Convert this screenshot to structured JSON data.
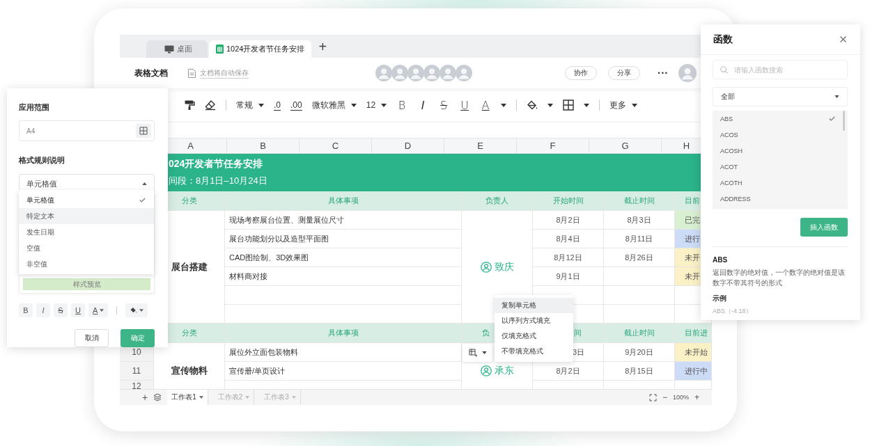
{
  "tabs": [
    {
      "label": "桌面",
      "kind": "desktop",
      "selected": false
    },
    {
      "label": "1024开发者节任务安排",
      "kind": "sheet",
      "selected": true
    }
  ],
  "new_tab": "+",
  "header": {
    "app": "表格文档",
    "autosave": "文档将自动保存",
    "collaborate": "协作",
    "share": "分享",
    "more": "•••"
  },
  "toolbar": {
    "number_format": "常规",
    "decrease_decimal": ".0",
    "increase_decimal": ".00",
    "font": "微软雅黑",
    "size": "12",
    "bold": "B",
    "italic": "I",
    "strike": "S",
    "underline": "U",
    "font_color": "A",
    "more": "更多"
  },
  "columns": [
    "A",
    "B",
    "C",
    "D",
    "E",
    "F",
    "G",
    "H"
  ],
  "sheet_title": "024开发者节任务安排",
  "period": "间段：8月1日–10月24日",
  "sections": [
    {
      "headers": {
        "category": "分类",
        "task": "具体事项",
        "owner": "负责人",
        "start": "开始时间",
        "end": "截止时间",
        "progress": "目前"
      },
      "category": "展台搭建",
      "owner": "致庆",
      "rows": [
        {
          "task": "现场考察展台位置、测量展位尺寸",
          "start": "8月2日",
          "end": "8月3日",
          "status": "已完",
          "color": "#d9efd1"
        },
        {
          "task": "展台功能划分以及造型平面图",
          "start": "8月4日",
          "end": "8月11日",
          "status": "进行",
          "color": "#cddcf6"
        },
        {
          "task": "CAD图绘制、3D效果图",
          "start": "8月12日",
          "end": "8月26日",
          "status": "未开",
          "color": "#fbf1c7"
        },
        {
          "task": "材料商对接",
          "start": "9月1日",
          "status": "未开",
          "color": "#fbf1c7"
        },
        {},
        {}
      ]
    },
    {
      "headers": {
        "category": "分类",
        "task": "具体事项",
        "owner": "负",
        "start": "间",
        "end": "截止时间",
        "progress": "目前进"
      },
      "category": "宣传物料",
      "owner": "承东",
      "rows": [
        {
          "num": "10",
          "task": "展位外立面包装物料",
          "start": "3日",
          "end": "9月20日",
          "status": "未开始",
          "color": "#fbf1c7"
        },
        {
          "num": "11",
          "task": "宣传册/单页设计",
          "start": "8月2日",
          "end": "8月15日",
          "status": "进行中",
          "color": "#cddcf6"
        },
        {
          "num": "12"
        }
      ]
    }
  ],
  "sheet_tabs": [
    {
      "label": "工作表1",
      "selected": true
    },
    {
      "label": "工作表2",
      "selected": false
    },
    {
      "label": "工作表3",
      "selected": false
    }
  ],
  "add_sheet": "+",
  "zoom": {
    "minus": "−",
    "value": "100%",
    "plus": "+"
  },
  "context_menu": [
    {
      "label": "复制单元格",
      "selected": true
    },
    {
      "label": "以序列方式填充",
      "selected": false
    },
    {
      "label": "仅填充格式",
      "selected": false
    },
    {
      "label": "不带填充格式",
      "selected": false
    }
  ],
  "format_panel": {
    "range_label": "应用范围",
    "range_value": "A4",
    "rule_label": "格式规则说明",
    "rule_value": "单元格值",
    "options": [
      {
        "label": "单元格值",
        "selected": true,
        "hovered": false
      },
      {
        "label": "特定文本",
        "selected": false,
        "hovered": true
      },
      {
        "label": "发生日期",
        "selected": false,
        "hovered": false
      },
      {
        "label": "空值",
        "selected": false,
        "hovered": false
      },
      {
        "label": "非空值",
        "selected": false,
        "hovered": false
      }
    ],
    "preview": "样式预览",
    "format": {
      "bold": "B",
      "italic": "I",
      "strike": "S",
      "underline": "U",
      "font_color": "A"
    },
    "cancel": "取消",
    "ok": "确定"
  },
  "function_panel": {
    "title": "函数",
    "search_placeholder": "请输入函数搜索",
    "category": "全部",
    "functions": [
      {
        "name": "ABS",
        "selected": true
      },
      {
        "name": "ACOS",
        "selected": false
      },
      {
        "name": "ACOSH",
        "selected": false
      },
      {
        "name": "ACOT",
        "selected": false
      },
      {
        "name": "ACOTH",
        "selected": false
      },
      {
        "name": "ADDRESS",
        "selected": false
      }
    ],
    "insert": "插入函数",
    "detail": {
      "name": "ABS",
      "description": "返回数字的绝对值，一个数字的绝对值是该数字不带其符号的形式",
      "example_label": "示例",
      "example": "ABS（-4.18）"
    }
  }
}
